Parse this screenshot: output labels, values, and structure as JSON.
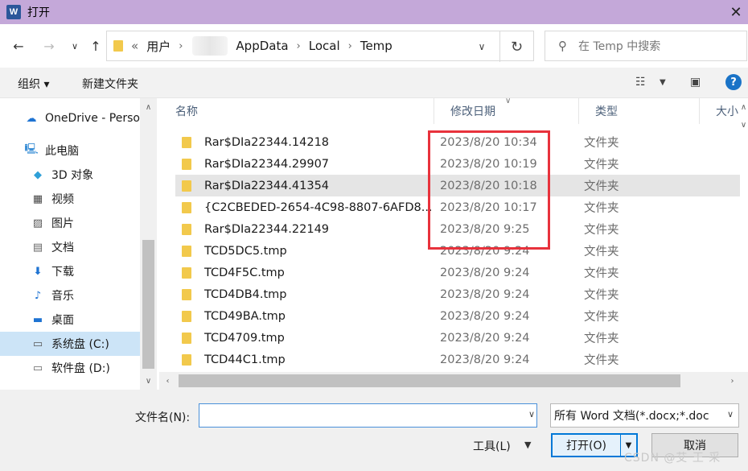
{
  "window": {
    "app_icon": "W",
    "title": "打开",
    "close": "✕"
  },
  "address": {
    "crumbs": [
      "«",
      "用户",
      "AppData",
      "Local",
      "Temp"
    ],
    "search_placeholder": "在 Temp 中搜索"
  },
  "toolbar": {
    "organize": "组织 ▾",
    "new_folder": "新建文件夹",
    "help": "?"
  },
  "nav": {
    "items": [
      {
        "label": "OneDrive - Perso",
        "icon": "cloud-icon"
      },
      {
        "label": "此电脑",
        "icon": "computer-icon"
      },
      {
        "label": "3D 对象",
        "icon": "cube-icon"
      },
      {
        "label": "视频",
        "icon": "video-icon"
      },
      {
        "label": "图片",
        "icon": "picture-icon"
      },
      {
        "label": "文档",
        "icon": "document-icon"
      },
      {
        "label": "下载",
        "icon": "download-icon"
      },
      {
        "label": "音乐",
        "icon": "music-icon"
      },
      {
        "label": "桌面",
        "icon": "desktop-icon"
      },
      {
        "label": "系统盘 (C:)",
        "icon": "drive-c-icon",
        "selected": true
      },
      {
        "label": "软件盘 (D:)",
        "icon": "drive-d-icon"
      }
    ]
  },
  "columns": {
    "name": "名称",
    "date": "修改日期",
    "type": "类型",
    "size": "大小"
  },
  "files": [
    {
      "name": "Rar$DIa22344.14218",
      "date": "2023/8/20 10:34",
      "type": "文件夹"
    },
    {
      "name": "Rar$DIa22344.29907",
      "date": "2023/8/20 10:19",
      "type": "文件夹"
    },
    {
      "name": "Rar$DIa22344.41354",
      "date": "2023/8/20 10:18",
      "type": "文件夹"
    },
    {
      "name": "{C2CBEDED-2654-4C98-8807-6AFD8...",
      "date": "2023/8/20 10:17",
      "type": "文件夹"
    },
    {
      "name": "Rar$DIa22344.22149",
      "date": "2023/8/20 9:25",
      "type": "文件夹"
    },
    {
      "name": "TCD5DC5.tmp",
      "date": "2023/8/20 9:24",
      "type": "文件夹"
    },
    {
      "name": "TCD4F5C.tmp",
      "date": "2023/8/20 9:24",
      "type": "文件夹"
    },
    {
      "name": "TCD4DB4.tmp",
      "date": "2023/8/20 9:24",
      "type": "文件夹"
    },
    {
      "name": "TCD49BA.tmp",
      "date": "2023/8/20 9:24",
      "type": "文件夹"
    },
    {
      "name": "TCD4709.tmp",
      "date": "2023/8/20 9:24",
      "type": "文件夹"
    },
    {
      "name": "TCD44C1.tmp",
      "date": "2023/8/20 9:24",
      "type": "文件夹"
    }
  ],
  "bottom": {
    "filename_label": "文件名(N):",
    "filename_value": "",
    "filetype": "所有 Word 文档(*.docx;*.doc",
    "tools": "工具(L)",
    "open": "打开(O)",
    "cancel": "取消"
  },
  "watermark": "CSDN @艾 王 采"
}
